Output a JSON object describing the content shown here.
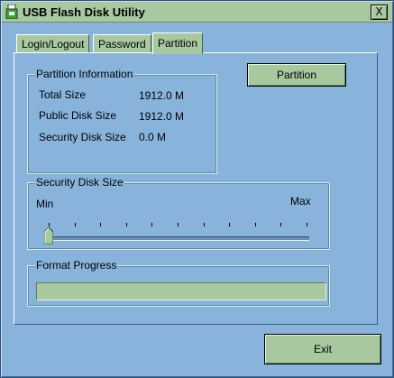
{
  "window": {
    "title": "USB Flash Disk Utility",
    "close_glyph": "X"
  },
  "tabs": [
    {
      "label": "Login/Logout",
      "active": false
    },
    {
      "label": "Password",
      "active": false
    },
    {
      "label": "Partition",
      "active": true
    }
  ],
  "partition_info": {
    "group_label": "Partition Information",
    "rows": [
      {
        "label": "Total Size",
        "value": "1912.0 M"
      },
      {
        "label": "Public Disk Size",
        "value": "1912.0 M"
      },
      {
        "label": "Security Disk Size",
        "value": "0.0 M"
      }
    ]
  },
  "partition_button": {
    "label": "Partition"
  },
  "security_slider": {
    "group_label": "Security Disk Size",
    "min_label": "Min",
    "max_label": "Max",
    "value_fraction": 0.0
  },
  "format_progress": {
    "group_label": "Format Progress",
    "value_fraction": 0.0
  },
  "exit_button": {
    "label": "Exit"
  },
  "colors": {
    "panel_bg": "#88b4dc",
    "control_bg": "#a8c8a0"
  }
}
